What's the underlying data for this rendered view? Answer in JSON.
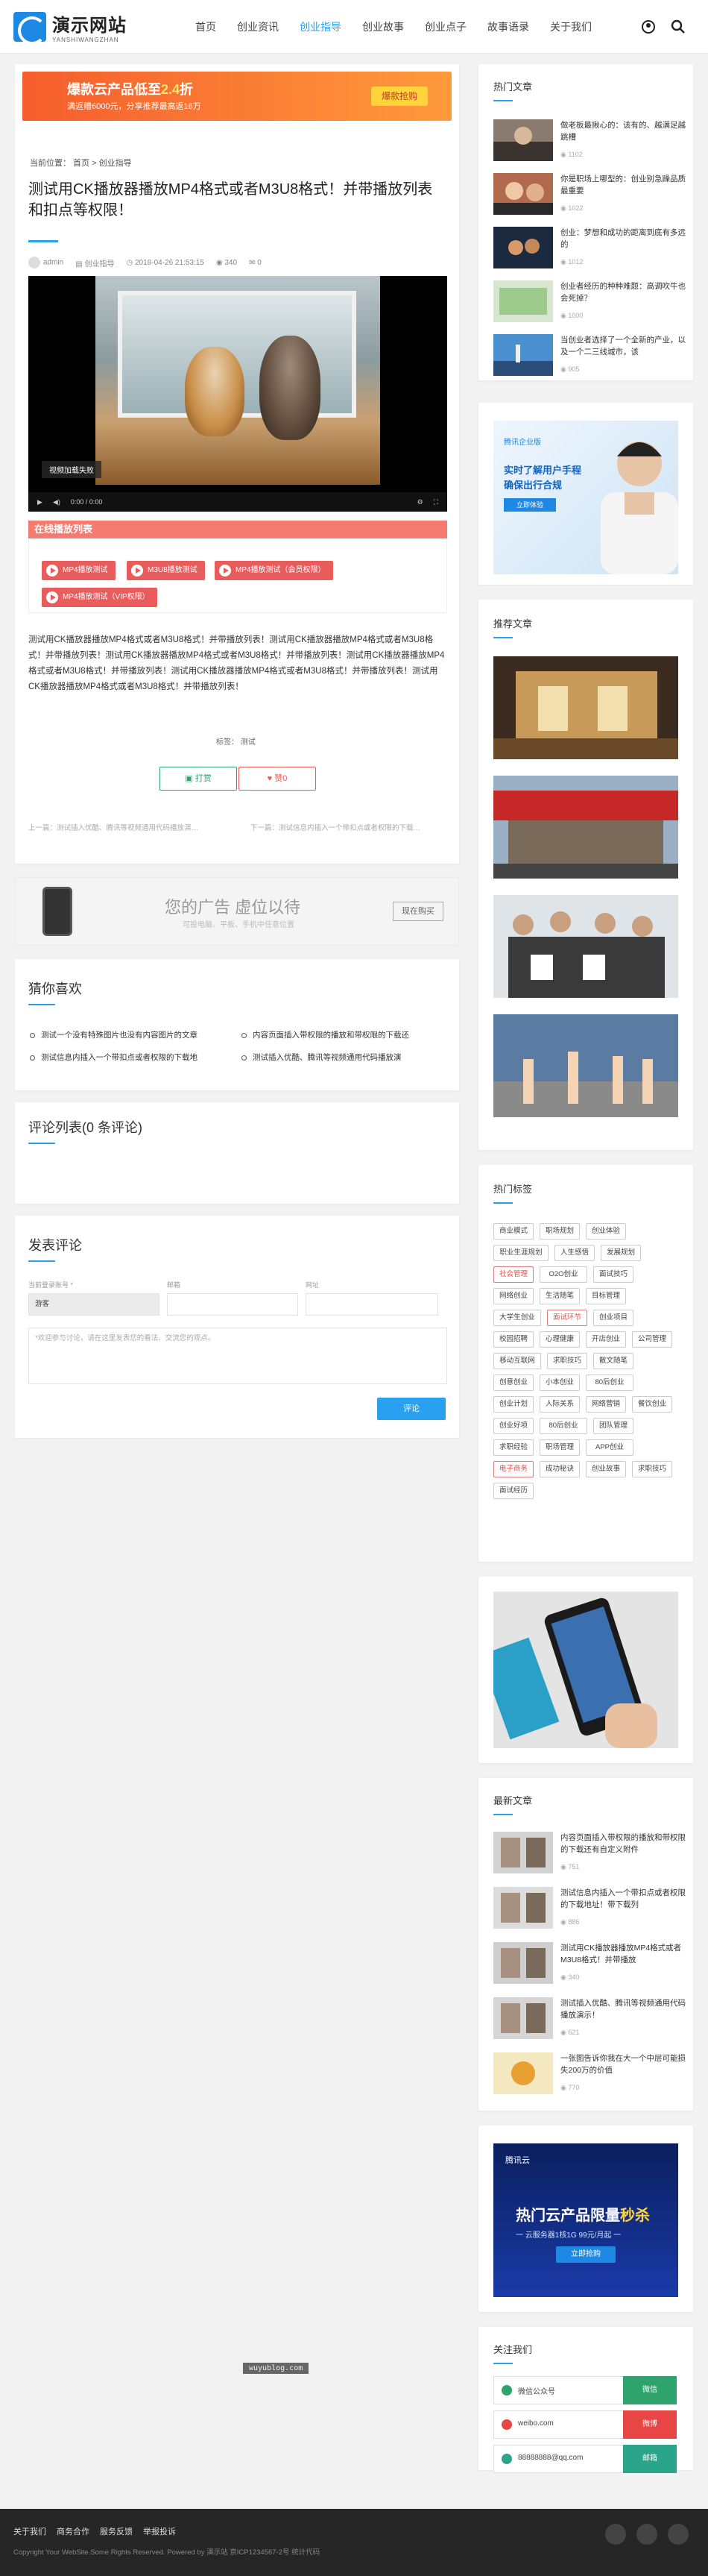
{
  "site": {
    "name": "演示网站",
    "sub": "YANSHIWANGZHAN"
  },
  "nav": [
    "首页",
    "创业资讯",
    "创业指导",
    "创业故事",
    "创业点子",
    "故事语录",
    "关于我们"
  ],
  "banner": {
    "line1_pre": "爆款云产品低至",
    "line1_hl": "2.4",
    "line1_post": "折",
    "line2": "满返赠6000元，分享推荐最高返16万",
    "button": "爆款抢购"
  },
  "article": {
    "breadcrumb": "当前位置：  首页  >  创业指导",
    "title": "测试用CK播放器播放MP4格式或者M3U8格式！并带播放列表和扣点等权限！",
    "author": "admin",
    "category": "创业指导",
    "date": "2018-04-26 21:53:15",
    "views": "340",
    "comments": "0",
    "loading": "视频加载失败",
    "time": "0:00 / 0:00",
    "playlist_title": "在线播放列表",
    "playlist": [
      "MP4播放测试",
      "M3U8播放测试",
      "MP4播放测试（会员权限）",
      "MP4播放测试（VIP权限）"
    ],
    "body": "测试用CK播放器播放MP4格式或者M3U8格式！并带播放列表！测试用CK播放器播放MP4格式或者M3U8格式！并带播放列表！测试用CK播放器播放MP4格式或者M3U8格式！并带播放列表！测试用CK播放器播放MP4格式或者M3U8格式！并带播放列表！测试用CK播放器播放MP4格式或者M3U8格式！并带播放列表！测试用CK播放器播放MP4格式或者M3U8格式！并带播放列表！",
    "tags_label": "标签：",
    "tag": "测试",
    "reward": "打赏",
    "like": "赞0",
    "prev": "上一篇：测试插入优酷、腾讯等视频通用代码播放演…",
    "next": "下一篇：测试信息内插入一个带扣点或者权限的下载…"
  },
  "ad": {
    "text": "您的广告 虚位以待",
    "sub": "可投电脑、平板、手机中任意位置",
    "button": "现在购买"
  },
  "guess": {
    "title": "猜你喜欢",
    "items": [
      "测试一个没有特殊图片也没有内容图片的文章",
      "内容页面插入带权限的播放和带权限的下载还",
      "测试信息内插入一个带扣点或者权限的下载地",
      "测试插入优酷、腾讯等视频通用代码播放演"
    ]
  },
  "comments": {
    "title": "评论列表(0 条评论)"
  },
  "form": {
    "title": "发表评论",
    "name_label": "当前登录账号 *",
    "name_value": "游客",
    "email_label": "邮箱",
    "url_label": "网址",
    "placeholder": "*欢迎参与讨论，请在这里发表您的看法、交流您的观点。",
    "submit": "评论"
  },
  "sidebar": {
    "hot_title": "热门文章",
    "hot": [
      {
        "title": "做老板最揪心的：该有的、越满足越跳槽",
        "views": "1102"
      },
      {
        "title": "你是职场上哪型的：创业别急躁品质最重要",
        "views": "1022"
      },
      {
        "title": "创业：梦想和成功的距离到底有多远的",
        "views": "1012"
      },
      {
        "title": "创业者经历的种种难题：高调吹牛也会死掉？",
        "views": "1000"
      },
      {
        "title": "当创业者选择了一个全新的产业，以及一个二三线城市，该",
        "views": "905"
      }
    ],
    "ad1": {
      "brand": "腾讯企业版",
      "l1": "实时了解用户手程",
      "l2": "确保出行合规",
      "btn": "立即体验"
    },
    "rec_title": "推荐文章",
    "tags_title": "热门标签",
    "tags": [
      "商业模式",
      "职场规划",
      "创业体验",
      "职业生涯规划",
      "人生感悟",
      "发展规划",
      "社会管理",
      "O2O创业",
      "面试技巧",
      "网络创业",
      "生活随笔",
      "目标管理",
      "大学生创业",
      "面试环节",
      "创业项目",
      "校园招聘",
      "心理健康",
      "开店创业",
      "公司管理",
      "移动互联网",
      "求职技巧",
      "散文随笔",
      "创意创业",
      "小本创业",
      "80后创业",
      "创业计划",
      "人际关系",
      "网络营销",
      "餐饮创业",
      "创业好项",
      "80后创业",
      "团队管理",
      "求职经验",
      "职场管理",
      "APP创业",
      "电子商务",
      "成功秘诀",
      "创业故事",
      "求职技巧",
      "面试经历"
    ],
    "new_title": "最新文章",
    "newest": [
      {
        "title": "内容页面插入带权限的播放和带权限的下载还有自定义附件",
        "views": "751"
      },
      {
        "title": "测试信息内插入一个带扣点或者权限的下载地址！带下载列",
        "views": "886"
      },
      {
        "title": "测试用CK播放器播放MP4格式或者M3U8格式！并带播放",
        "views": "340"
      },
      {
        "title": "测试插入优酷、腾讯等视频通用代码播放演示！",
        "views": "621"
      },
      {
        "title": "一张图告诉你我在大一个中层可能损失200万的价值",
        "views": "770"
      }
    ],
    "ad2": {
      "brand": "腾讯云",
      "t1": "热门云产品限量",
      "t2": "秒杀",
      "t3": "一 云服务器1核1G  99元/月起 一",
      "btn": "立即抢购"
    },
    "follow_title": "关注我们",
    "follow": [
      {
        "label": "微信公众号",
        "btn": "微信"
      },
      {
        "label": "weibo.com",
        "btn": "微博"
      },
      {
        "label": "88888888@qq.com",
        "btn": "邮箱"
      }
    ]
  },
  "watermark": "wuyublog.com",
  "footer": {
    "links": [
      "关于我们",
      "商务合作",
      "服务反馈",
      "举报投诉"
    ],
    "copy": "Copyright Your WebSite.Some Rights Reserved. Powered by 演示站 京ICP1234567-2号 统计代码"
  },
  "colors": {
    "accent": "#2aa0f0",
    "red": "#e85c5c",
    "green": "#2ea36c",
    "weibo": "#e84545"
  }
}
